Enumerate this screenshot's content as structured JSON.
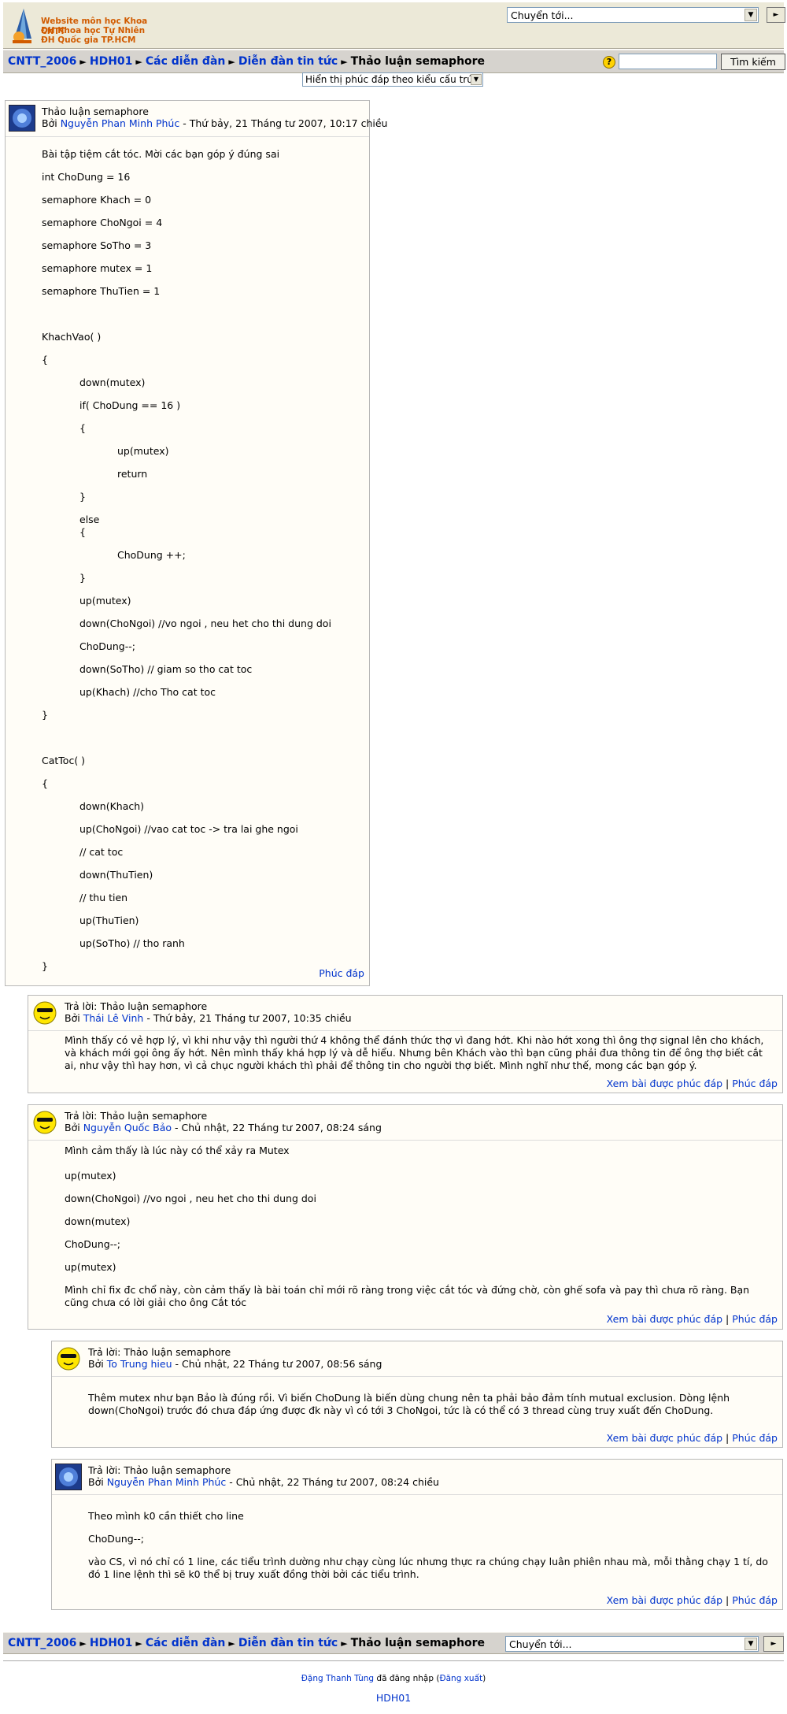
{
  "header": {
    "logo_lines": [
      "Website môn học Khoa CNTT",
      "ĐH Khoa học Tự Nhiên",
      "ĐH Quốc gia TP.HCM"
    ],
    "jump_label": "Chuyển tới...",
    "go_label": "►"
  },
  "breadcrumb": {
    "items": [
      "CNTT_2006",
      "HDH01",
      "Các diễn đàn",
      "Diễn đàn tin tức"
    ],
    "current": "Thảo luận semaphore",
    "separator": "►"
  },
  "search": {
    "button_label": "Tìm kiếm",
    "value": ""
  },
  "display_mode": "Hiển thị phúc đáp theo kiểu cấu trúc",
  "posts": [
    {
      "subject": "Thảo luận semaphore",
      "by_prefix": "Bởi",
      "author": "Nguyễn Phan Minh Phúc",
      "date": "- Thứ bảy, 21 Tháng tư 2007, 10:17 chiều",
      "lines": [
        "Bài tập tiệm cắt tóc. Mời các bạn góp ý đúng sai",
        "int ChoDung = 16",
        "semaphore Khach = 0",
        "semaphore ChoNgoi = 4",
        "semaphore SoTho = 3",
        "semaphore mutex = 1",
        "semaphore ThuTien = 1",
        "KhachVao(  )",
        "{",
        "down(mutex)",
        "if( ChoDung == 16 )",
        "{",
        "up(mutex)",
        "return",
        "}",
        "else",
        "{",
        "ChoDung ++;",
        "}",
        "up(mutex)",
        "down(ChoNgoi)  //vo ngoi , neu het cho thi dung doi",
        "ChoDung--;",
        "down(SoTho) // giam so tho cat toc",
        "up(Khach) //cho Tho cat toc",
        "}",
        "CatToc(  )",
        "{",
        "down(Khach)",
        "up(ChoNgoi)      //vao cat toc -> tra lai ghe ngoi",
        "// cat toc",
        "down(ThuTien)",
        "// thu tien",
        "up(ThuTien)",
        "up(SoTho) // tho ranh",
        "}"
      ],
      "reply_label": "Phúc đáp"
    },
    {
      "subject": "Trả lời: Thảo luận semaphore",
      "by_prefix": "Bởi",
      "author": "Thái Lê Vinh",
      "date": "- Thứ bảy, 21 Tháng tư 2007, 10:35 chiều",
      "lines": [
        "Mình thấy có vẻ hợp lý, vì khi như vậy thì người thứ 4 không thể đánh thức thợ vì đang hớt. Khi nào hớt xong thì ông thợ signal lên cho khách, và khách mới gọi ông ấy hớt. Nên mình thấy khá hợp lý và dễ hiểu. Nhưng bên Khách vào thì bạn cũng phải đưa thông tin để ông thợ biết cắt ai, như vậy thì hay hơn, vì cả chục người khách thì phải để thông tin cho người thợ biết. Mình nghĩ như thế, mong các bạn góp ý."
      ],
      "parent_label": "Xem bài được phúc đáp",
      "reply_label": "Phúc đáp"
    },
    {
      "subject": "Trả lời: Thảo luận semaphore",
      "by_prefix": "Bởi",
      "author": "Nguyễn Quốc Bảo",
      "date": "- Chủ nhật, 22 Tháng tư 2007, 08:24 sáng",
      "lines": [
        "Mình cảm thấy là lúc này có thể xảy ra Mutex",
        "up(mutex)",
        "down(ChoNgoi) //vo ngoi , neu het cho thi dung doi",
        "down(mutex)",
        "ChoDung--;",
        "up(mutex)",
        "Mình chỉ fix đc chổ này, còn cảm thấy là bài toán chỉ mới rõ ràng trong việc cắt tóc và đứng chờ, còn ghế sofa và pay thì chưa rõ ràng. Bạn cũng chưa có lời giải cho ông Cắt tóc"
      ],
      "parent_label": "Xem bài được phúc đáp",
      "reply_label": "Phúc đáp"
    },
    {
      "subject": "Trả lời: Thảo luận semaphore",
      "by_prefix": "Bởi",
      "author": "To Trung hieu",
      "date": "- Chủ nhật, 22 Tháng tư 2007, 08:56 sáng",
      "lines": [
        "Thêm mutex như bạn Bảo là đúng rồi. Vì biến ChoDung là biến dùng chung nên ta phải bảo đảm tính mutual exclusion. Dòng lệnh down(ChoNgoi) trước đó chưa đáp ứng được đk này vì có tới 3 ChoNgoi, tức là có thể có 3 thread cùng truy xuất đến ChoDung."
      ],
      "parent_label": "Xem bài được phúc đáp",
      "reply_label": "Phúc đáp"
    },
    {
      "subject": "Trả lời: Thảo luận semaphore",
      "by_prefix": "Bởi",
      "author": "Nguyễn Phan Minh Phúc",
      "date": "- Chủ nhật, 22 Tháng tư 2007, 08:24 chiều",
      "lines": [
        "Theo mình k0 cần thiết cho line",
        "ChoDung--;",
        "vào CS, vì nó chỉ có 1 line, các tiểu trình dường như chạy cùng lúc nhưng thực ra chúng chạy luân phiên nhau mà, mỗi thằng chạy 1 tí, do đó 1 line lệnh thì sẽ k0 thể bị truy xuất đồng thời bởi các tiểu trình."
      ],
      "parent_label": "Xem bài được phúc đáp",
      "reply_label": "Phúc đáp"
    }
  ],
  "separator_pipe": "|",
  "footer": {
    "user": "Đặng Thanh Tùng",
    "logged_in_text": "đã đăng nhập",
    "logout": "Đăng xuất",
    "course": "HDH01"
  }
}
